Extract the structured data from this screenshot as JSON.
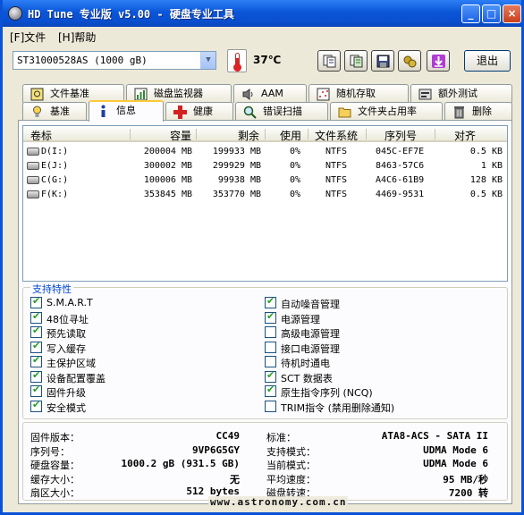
{
  "window": {
    "title": "HD Tune 专业版 v5.00 - 硬盘专业工具"
  },
  "colors": {
    "titlebar": "#0a56d8",
    "accent_tab": "#ffc83c",
    "features_legend": "#0046d5",
    "check": "#21a121"
  },
  "menu": {
    "file": "[F]文件",
    "help": "[H]帮助"
  },
  "toolbar": {
    "drive": "ST31000528AS (1000 gB)",
    "temperature": "37℃",
    "exit": "退出",
    "icons": [
      "copy-info-icon",
      "copy-all-icon",
      "save-icon",
      "options-icon",
      "download-icon"
    ]
  },
  "tabs_top": [
    {
      "label": "文件基准",
      "icon": "file-benchmark-icon"
    },
    {
      "label": "磁盘监视器",
      "icon": "disk-monitor-icon"
    },
    {
      "label": "AAM",
      "icon": "speaker-icon"
    },
    {
      "label": "随机存取",
      "icon": "random-access-icon"
    },
    {
      "label": "额外测试",
      "icon": "extra-tests-icon"
    }
  ],
  "tabs_bottom": [
    {
      "label": "基准",
      "icon": "benchmark-icon"
    },
    {
      "label": "信息",
      "icon": "info-icon",
      "active": true
    },
    {
      "label": "健康",
      "icon": "health-icon"
    },
    {
      "label": "错误扫描",
      "icon": "error-scan-icon"
    },
    {
      "label": "文件夹占用率",
      "icon": "folder-usage-icon"
    },
    {
      "label": "删除",
      "icon": "erase-icon"
    }
  ],
  "columns": [
    "卷标",
    "容量",
    "剩余",
    "使用",
    "文件系统",
    "序列号",
    "对齐"
  ],
  "volumes": [
    {
      "label": "D(I:)",
      "capacity": "200004 MB",
      "free": "199933 MB",
      "used": "0%",
      "fs": "NTFS",
      "serial": "045C-EF7E",
      "align": "0.5 KB"
    },
    {
      "label": "E(J:)",
      "capacity": "300002 MB",
      "free": "299929 MB",
      "used": "0%",
      "fs": "NTFS",
      "serial": "8463-57C6",
      "align": "1 KB"
    },
    {
      "label": "C(G:)",
      "capacity": "100006 MB",
      "free": "99938 MB",
      "used": "0%",
      "fs": "NTFS",
      "serial": "A4C6-61B9",
      "align": "128 KB"
    },
    {
      "label": "F(K:)",
      "capacity": "353845 MB",
      "free": "353770 MB",
      "used": "0%",
      "fs": "NTFS",
      "serial": "4469-9531",
      "align": "0.5 KB"
    }
  ],
  "features": {
    "legend": "支持特性",
    "left": [
      {
        "label": "S.M.A.R.T",
        "checked": true
      },
      {
        "label": "48位寻址",
        "checked": true
      },
      {
        "label": "预先读取",
        "checked": true
      },
      {
        "label": "写入缓存",
        "checked": true
      },
      {
        "label": "主保护区域",
        "checked": true
      },
      {
        "label": "设备配置覆盖",
        "checked": true
      },
      {
        "label": "固件升级",
        "checked": true
      },
      {
        "label": "安全模式",
        "checked": true
      }
    ],
    "right": [
      {
        "label": "自动噪音管理",
        "checked": true
      },
      {
        "label": "电源管理",
        "checked": true
      },
      {
        "label": "高级电源管理",
        "checked": false
      },
      {
        "label": "接口电源管理",
        "checked": false
      },
      {
        "label": "待机时通电",
        "checked": false
      },
      {
        "label": "SCT 数据表",
        "checked": true
      },
      {
        "label": "原生指令序列 (NCQ)",
        "checked": true
      },
      {
        "label": "TRIM指令 (禁用删除通知)",
        "checked": false
      }
    ]
  },
  "info_left": [
    {
      "label": "固件版本：",
      "value": "CC49"
    },
    {
      "label": "序列号：",
      "value": "9VP6G5GY"
    },
    {
      "label": "硬盘容量：",
      "value": "1000.2 gB (931.5 GB)"
    },
    {
      "label": "缓存大小：",
      "value": "无"
    },
    {
      "label": "扇区大小：",
      "value": "512 bytes"
    }
  ],
  "info_right": [
    {
      "label": "标准：",
      "value": "ATA8-ACS - SATA II"
    },
    {
      "label": "支持模式：",
      "value": "UDMA Mode 6"
    },
    {
      "label": "当前模式：",
      "value": "UDMA Mode 6"
    },
    {
      "label": "平均速度：",
      "value": "95 MB/秒"
    },
    {
      "label": "磁盘转速：",
      "value": "7200 转"
    }
  ],
  "watermark": "www.astronomy.com.cn"
}
